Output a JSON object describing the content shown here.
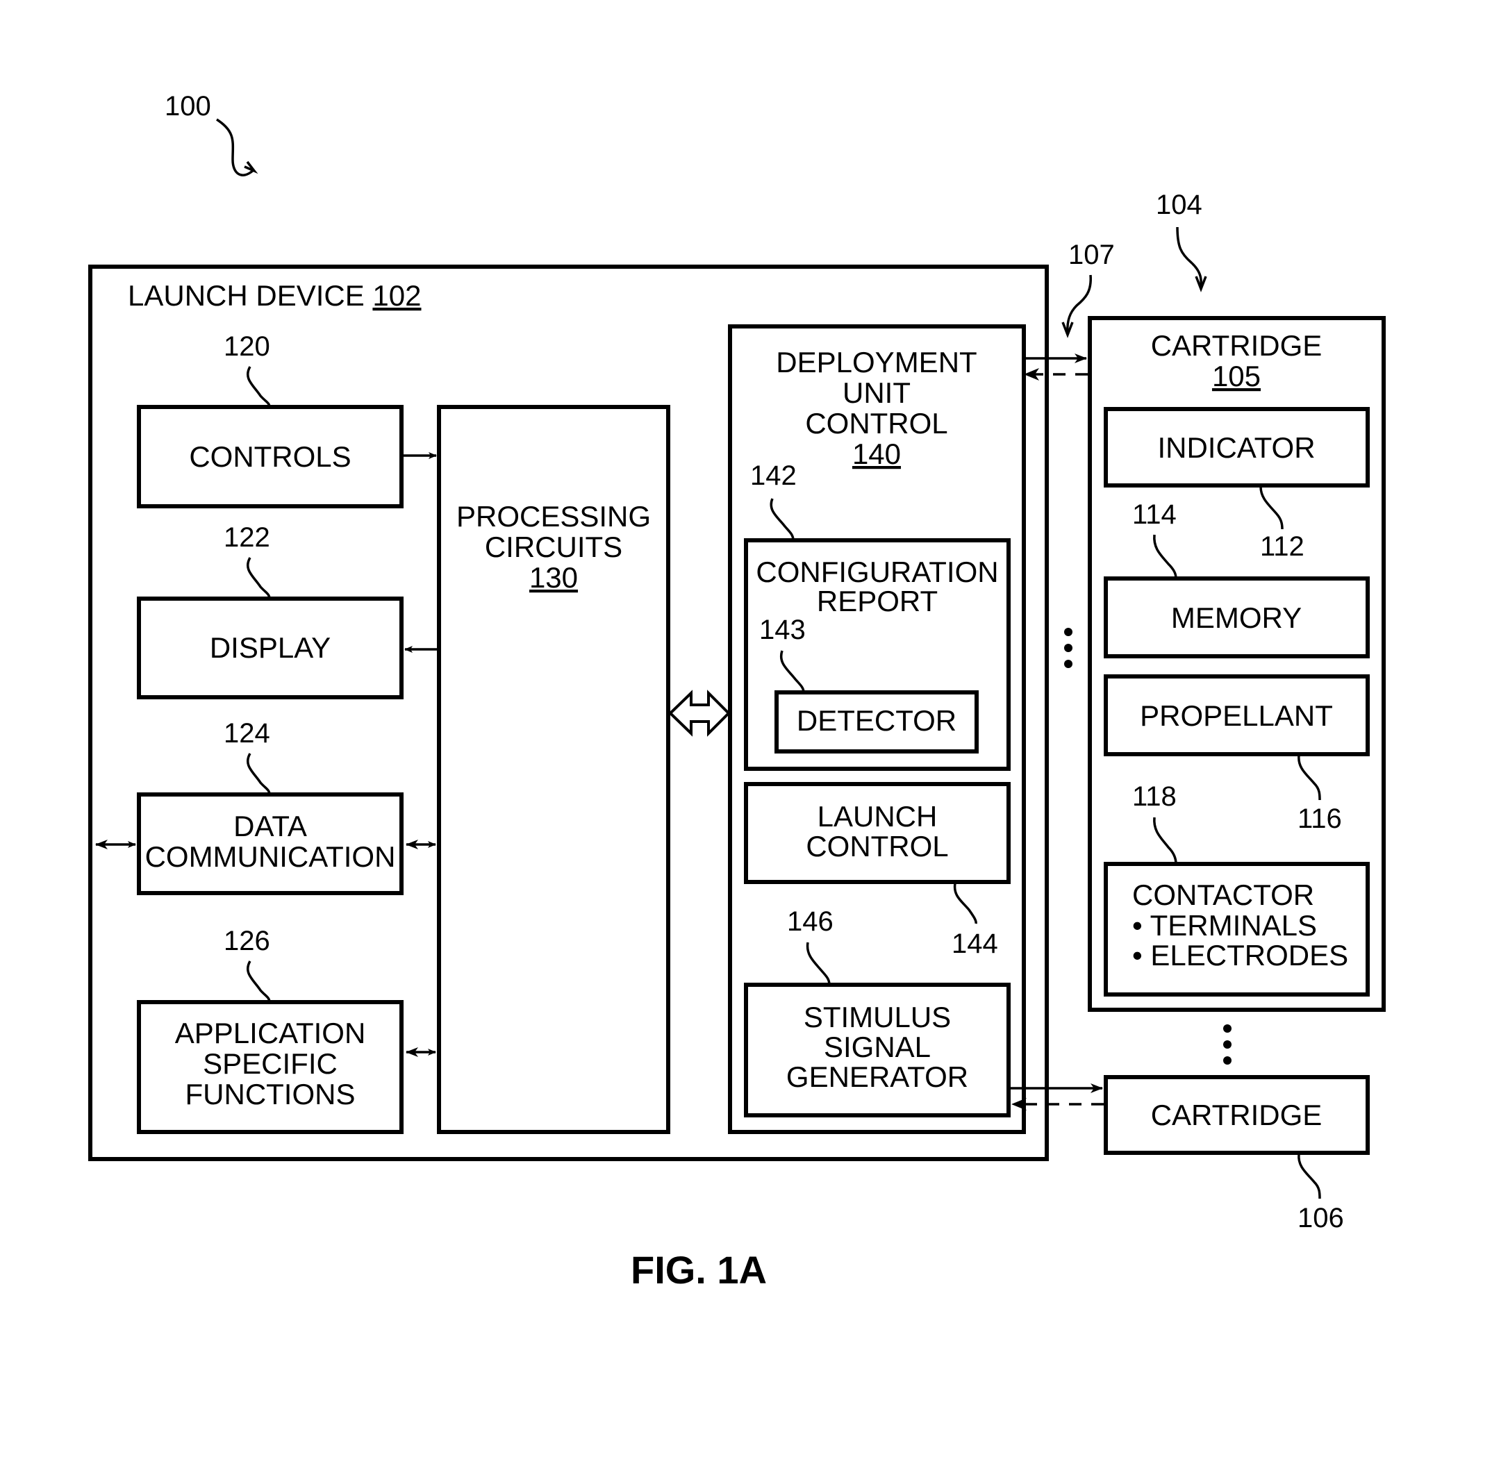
{
  "figure": {
    "caption": "FIG. 1A",
    "system_ref": "100"
  },
  "launch_device": {
    "title": "LAUNCH DEVICE",
    "ref": "102",
    "controls": {
      "label": "CONTROLS",
      "ref": "120"
    },
    "display": {
      "label": "DISPLAY",
      "ref": "122"
    },
    "data_communication": {
      "lines": [
        "DATA",
        "COMMUNICATION"
      ],
      "ref": "124"
    },
    "application_specific_functions": {
      "lines": [
        "APPLICATION",
        "SPECIFIC",
        "FUNCTIONS"
      ],
      "ref": "126"
    },
    "processing_circuits": {
      "lines": [
        "PROCESSING",
        "CIRCUITS"
      ],
      "ref": "130"
    },
    "deployment_unit_control": {
      "lines": [
        "DEPLOYMENT",
        "UNIT",
        "CONTROL"
      ],
      "ref": "140",
      "configuration_report": {
        "lines": [
          "CONFIGURATION",
          "REPORT"
        ],
        "ref": "142"
      },
      "detector": {
        "label": "DETECTOR",
        "ref": "143"
      },
      "launch_control": {
        "lines": [
          "LAUNCH",
          "CONTROL"
        ],
        "ref": "144"
      },
      "stimulus_signal_generator": {
        "lines": [
          "STIMULUS",
          "SIGNAL",
          "GENERATOR"
        ],
        "ref": "146"
      }
    }
  },
  "interface_ref": "107",
  "cartridges_ref": "104",
  "cartridge_105": {
    "title": "CARTRIDGE",
    "ref": "105",
    "indicator": {
      "label": "INDICATOR",
      "ref": "112"
    },
    "memory": {
      "label": "MEMORY",
      "ref": "114"
    },
    "propellant": {
      "label": "PROPELLANT",
      "ref": "116"
    },
    "contactor": {
      "lines": [
        "CONTACTOR",
        "• TERMINALS",
        "• ELECTRODES"
      ],
      "ref": "118"
    }
  },
  "cartridge_106": {
    "label": "CARTRIDGE",
    "ref": "106"
  }
}
